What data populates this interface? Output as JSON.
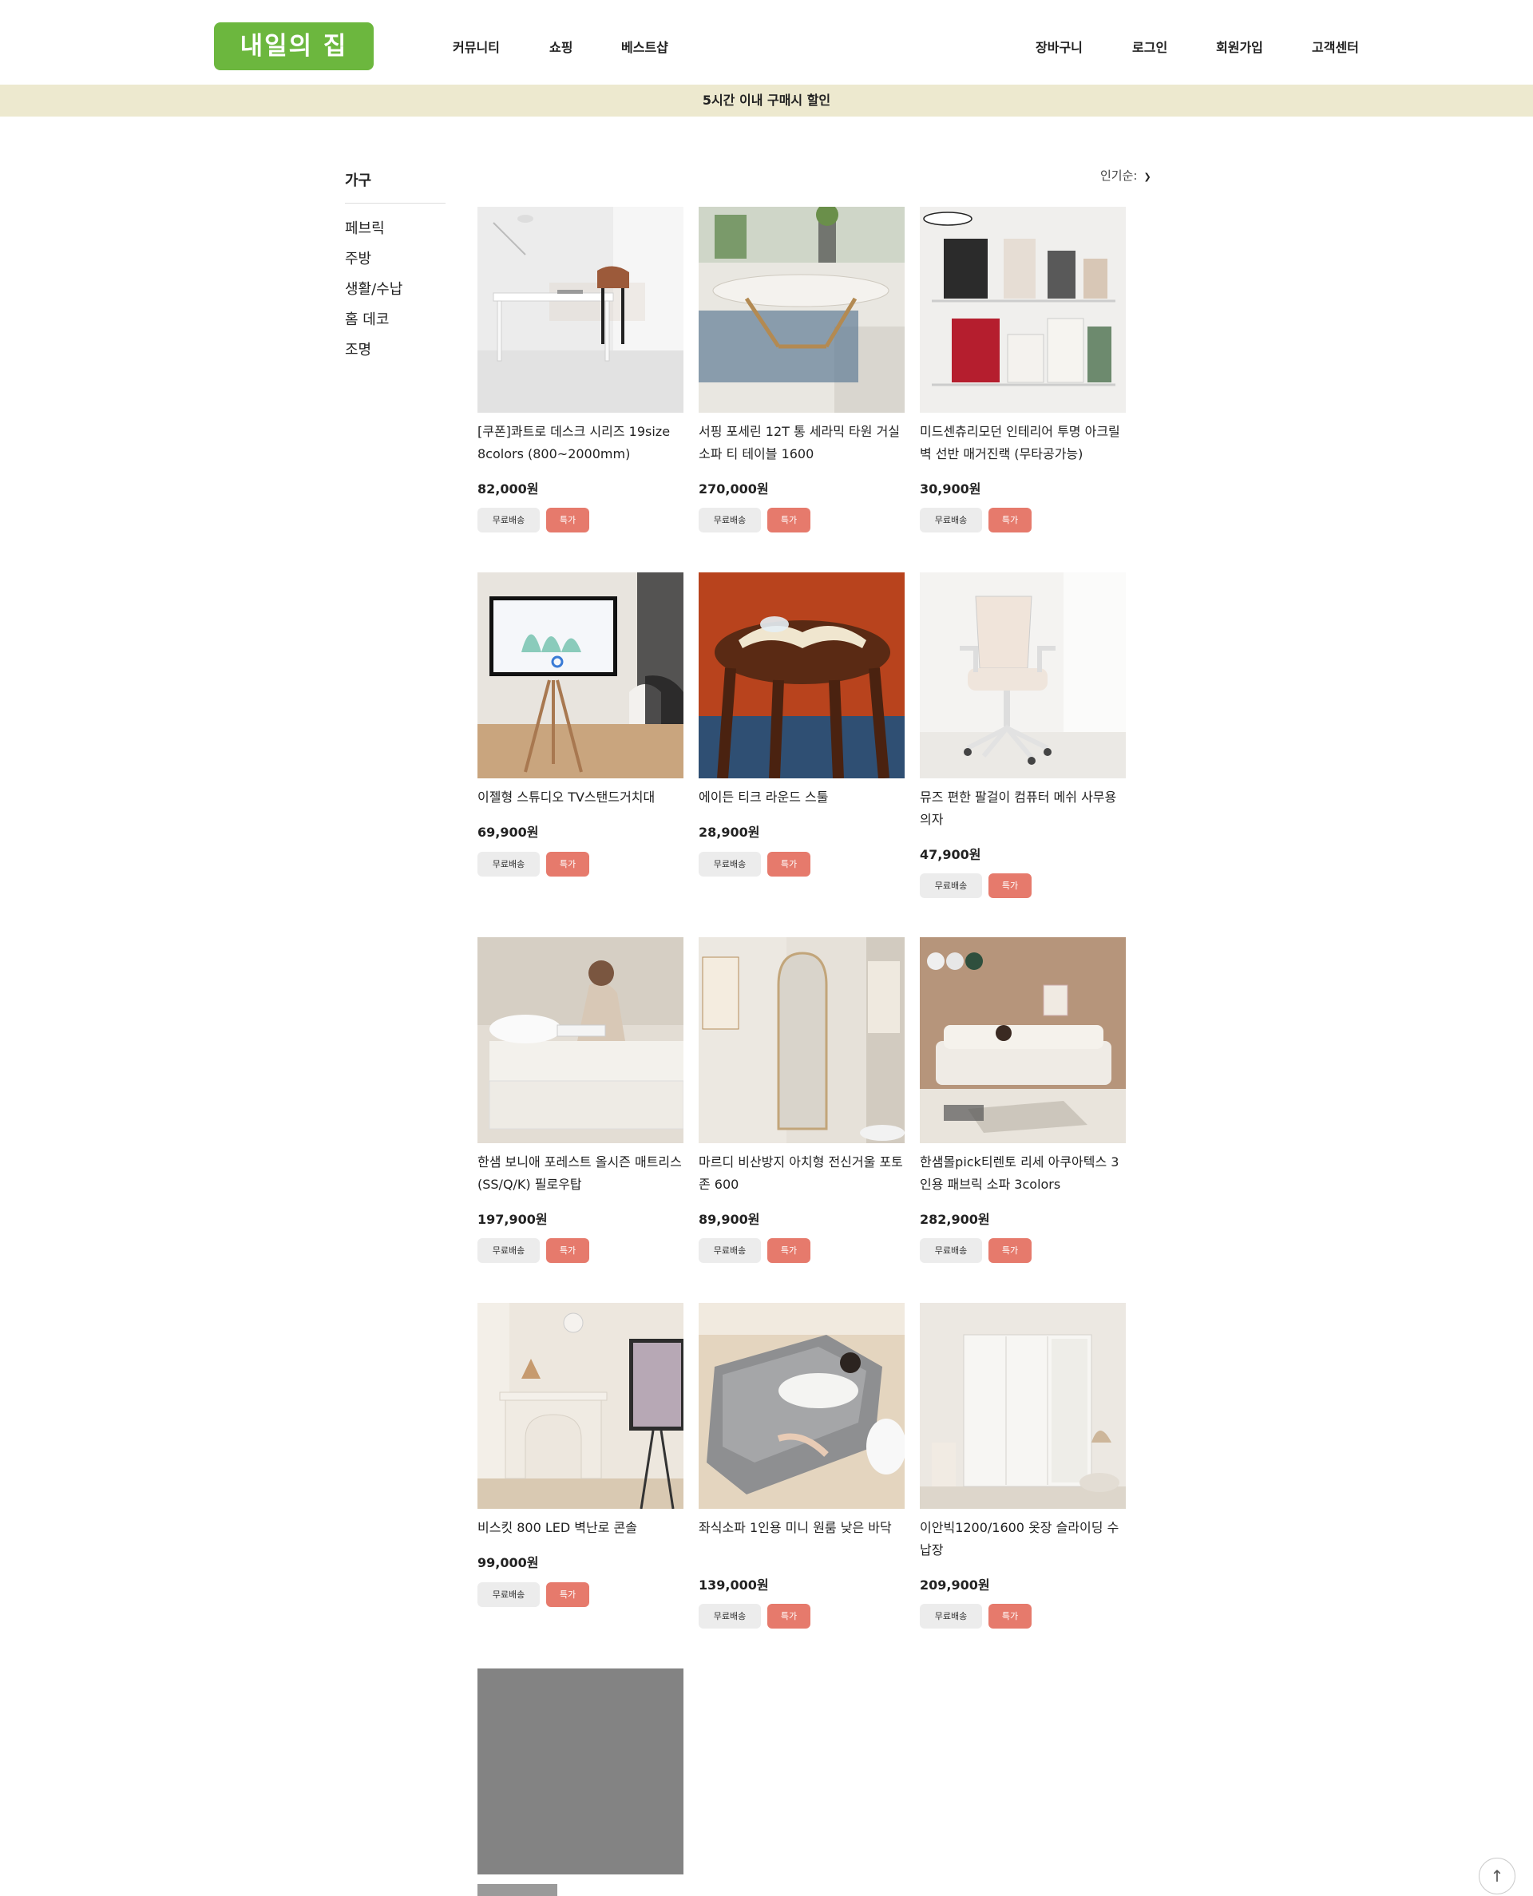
{
  "header": {
    "logo": "내일의 집",
    "nav_left": [
      "커뮤니티",
      "쇼핑",
      "베스트샵"
    ],
    "nav_right": [
      "장바구니",
      "로그인",
      "회원가입",
      "고객센터"
    ]
  },
  "banner": "5시간 이내 구매시 할인",
  "sidebar": {
    "title": "가구",
    "items": [
      "페브릭",
      "주방",
      "생활/수납",
      "홈 데코",
      "조명"
    ]
  },
  "sort": {
    "label": "인기순:",
    "icon": "chevron-down-icon"
  },
  "badges": {
    "free": "무료배송",
    "sale": "특가"
  },
  "products": [
    {
      "name": "[쿠폰]콰트로 데스크 시리즈 19size 8colors (800~2000mm)",
      "price": "82,000원"
    },
    {
      "name": "서핑 포세린 12T 통 세라믹 타원 거실 소파 티 테이블 1600",
      "price": "270,000원"
    },
    {
      "name": "미드센츄리모던 인테리어 투명 아크릴 벽 선반 매거진랙 (무타공가능)",
      "price": "30,900원"
    },
    {
      "name": "이젤형 스튜디오 TV스탠드거치대",
      "price": "69,900원"
    },
    {
      "name": "에이든 티크 라운드 스툴",
      "price": "28,900원"
    },
    {
      "name": "뮤즈 편한 팔걸이 컴퓨터 메쉬 사무용의자",
      "price": "47,900원"
    },
    {
      "name": "한샘 보니애 포레스트 올시즌 매트리스(SS/Q/K) 필로우탑",
      "price": "197,900원"
    },
    {
      "name": "마르디 비산방지 아치형 전신거울 포토존 600",
      "price": "89,900원"
    },
    {
      "name": "한샘몰pick티렌토 리세 아쿠아텍스 3인용 패브릭 소파 3colors",
      "price": "282,900원"
    },
    {
      "name": "비스킷 800 LED 벽난로 콘솔",
      "price": "99,000원"
    },
    {
      "name": "좌식소파 1인용 미니 원룸 낮은 바닥",
      "price": "139,000원"
    },
    {
      "name": "이안빅1200/1600 옷장 슬라이딩 수납장",
      "price": "209,900원"
    }
  ],
  "to_top": "↑"
}
